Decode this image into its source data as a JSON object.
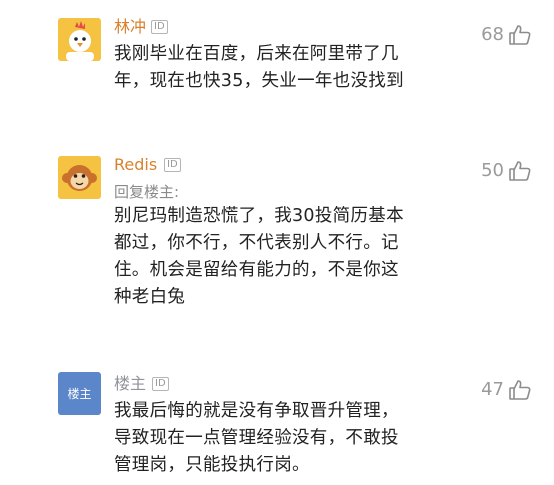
{
  "comments": [
    {
      "username": "林冲",
      "id_badge": "ID",
      "reply_to": "",
      "text_lines": [
        "我刚毕业在百度，后来在阿里带了几",
        "年，现在也快35，失业一年也没找到"
      ],
      "likes": "68",
      "avatar": "chick-icon"
    },
    {
      "username": "Redis",
      "id_badge": "ID",
      "reply_to": "回复楼主:",
      "text_lines": [
        "别尼玛制造恐慌了，我30投简历基本",
        "都过，你不行，不代表别人不行。记",
        "住。机会是留给有能力的，不是你这",
        "种老白兔"
      ],
      "likes": "50",
      "avatar": "monkey-icon"
    },
    {
      "username": "楼主",
      "id_badge": "ID",
      "reply_to": "",
      "text_lines": [
        "我最后悔的就是没有争取晋升管理，",
        "导致现在一点管理经验没有，不敢投",
        "管理岗，只能投执行岗。"
      ],
      "likes": "47",
      "avatar_label": "楼主"
    }
  ],
  "colors": {
    "username_orange": "#d9822b",
    "username_grey": "#909399",
    "op_avatar_bg": "#5b86c9"
  }
}
